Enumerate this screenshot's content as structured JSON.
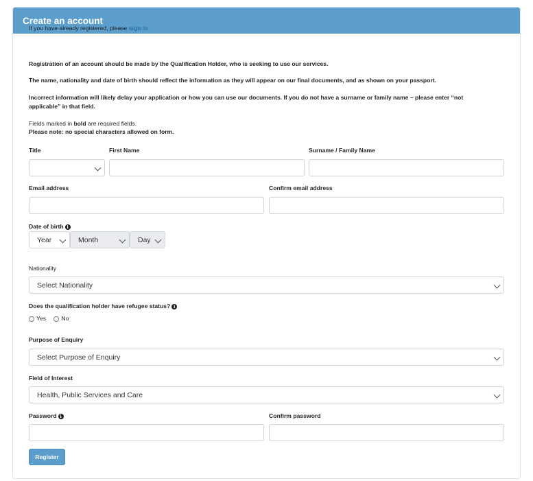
{
  "header": {
    "title": "Create an account"
  },
  "intro": {
    "signin_prefix": "If you have already registered, please ",
    "signin_link": "sign in",
    "line1": "Registration of an account should be made by the Qualification Holder, who is seeking to use our services.",
    "line2": "The name, nationality and date of birth should reflect the information as they will appear on our final documents, and as shown on your passport.",
    "line3": "Incorrect information will likely delay your application or how you can use our documents. If you do not have a surname or family name – please enter “not applicable” in that field.",
    "required_prefix": "Fields marked in ",
    "required_bold": "bold",
    "required_suffix": " are required fields.",
    "note": "Please note: no special characters allowed on form."
  },
  "form": {
    "title": {
      "label": "Title",
      "value": ""
    },
    "first_name": {
      "label": "First Name",
      "value": ""
    },
    "surname": {
      "label": "Surname / Family Name",
      "value": ""
    },
    "email": {
      "label": "Email address",
      "value": ""
    },
    "confirm_email": {
      "label": "Confirm email address",
      "value": ""
    },
    "dob": {
      "label": "Date of birth",
      "year": "Year",
      "month": "Month",
      "day": "Day"
    },
    "nationality": {
      "label": "Nationality",
      "value": "Select Nationality"
    },
    "refugee": {
      "label": "Does the qualification holder have refugee status?",
      "yes": "Yes",
      "no": "No"
    },
    "purpose": {
      "label": "Purpose of Enquiry",
      "value": "Select Purpose of Enquiry"
    },
    "field_of_interest": {
      "label": "Field of Interest",
      "value": "Health, Public Services and Care"
    },
    "password": {
      "label": "Password",
      "value": ""
    },
    "confirm_password": {
      "label": "Confirm password",
      "value": ""
    },
    "register_label": "Register"
  },
  "colors": {
    "header_bg": "#5b9dcb",
    "link": "#2a6ea8",
    "button_bg": "#5b9dcb"
  }
}
